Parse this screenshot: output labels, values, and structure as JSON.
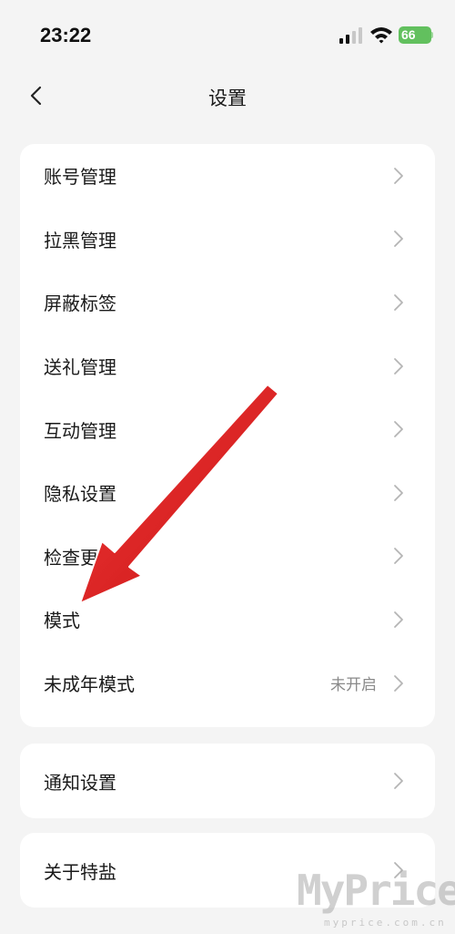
{
  "status_bar": {
    "time": "23:22",
    "battery": "66"
  },
  "nav": {
    "title": "设置"
  },
  "main_menu": [
    {
      "label": "账号管理",
      "value": ""
    },
    {
      "label": "拉黑管理",
      "value": ""
    },
    {
      "label": "屏蔽标签",
      "value": ""
    },
    {
      "label": "送礼管理",
      "value": ""
    },
    {
      "label": "互动管理",
      "value": ""
    },
    {
      "label": "隐私设置",
      "value": ""
    },
    {
      "label": "检查更",
      "value": ""
    },
    {
      "label": "模式",
      "value": ""
    },
    {
      "label": "未成年模式",
      "value": "未开启"
    }
  ],
  "notify_menu": {
    "label": "通知设置"
  },
  "about_menu": {
    "label": "关于特盐"
  },
  "watermark": {
    "main": "MyPrice",
    "sub": "myprice.com.cn"
  },
  "colors": {
    "annotation_arrow": "#e01b1b",
    "battery": "#62c05e",
    "card": "#ffffff",
    "background": "#f4f4f4"
  }
}
